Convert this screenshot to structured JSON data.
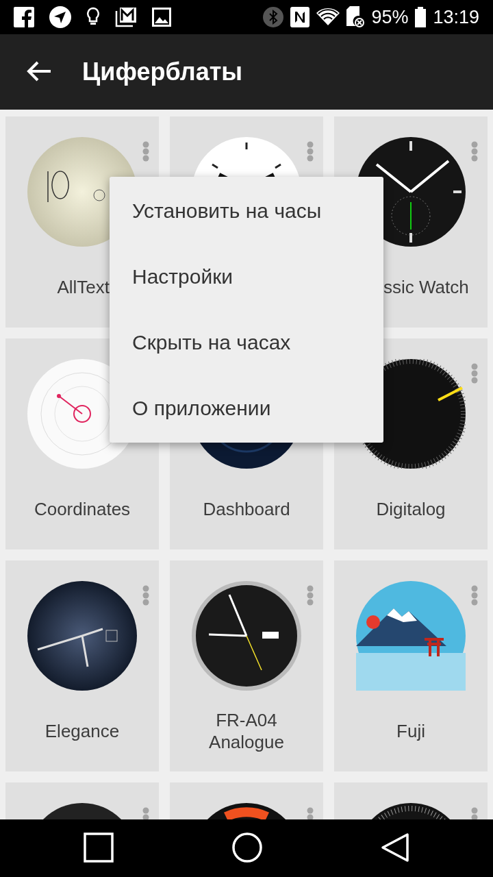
{
  "status_bar": {
    "battery": "95%",
    "time": "13:19"
  },
  "app_bar": {
    "title": "Циферблаты"
  },
  "watch_faces": [
    {
      "kind": "cream",
      "label": "AllText",
      "label_partly_hidden": true
    },
    {
      "kind": "white"
    },
    {
      "kind": "subdial",
      "label": "ssic Watch",
      "label_partly_hidden": true
    },
    {
      "kind": "rings",
      "label": "Coordinates",
      "label_partly_hidden": false
    },
    {
      "kind": "navy",
      "label": "Dashboard",
      "label_partly_hidden": false
    },
    {
      "kind": "yellowline",
      "label": "Digitalog",
      "label_partly_hidden": false
    },
    {
      "kind": "steel",
      "label": "Elegance",
      "label_partly_hidden": false
    },
    {
      "kind": "analog",
      "label": "FR-A04 Analogue",
      "label_partly_hidden": false
    },
    {
      "kind": "landscape",
      "label": "Fuji",
      "label_partly_hidden": false
    },
    {
      "kind": "dark"
    },
    {
      "kind": "orangearc"
    },
    {
      "kind": "ticks"
    }
  ],
  "menu": {
    "items": [
      "Установить на часы",
      "Настройки",
      "Скрыть на часах",
      "О приложении"
    ]
  }
}
